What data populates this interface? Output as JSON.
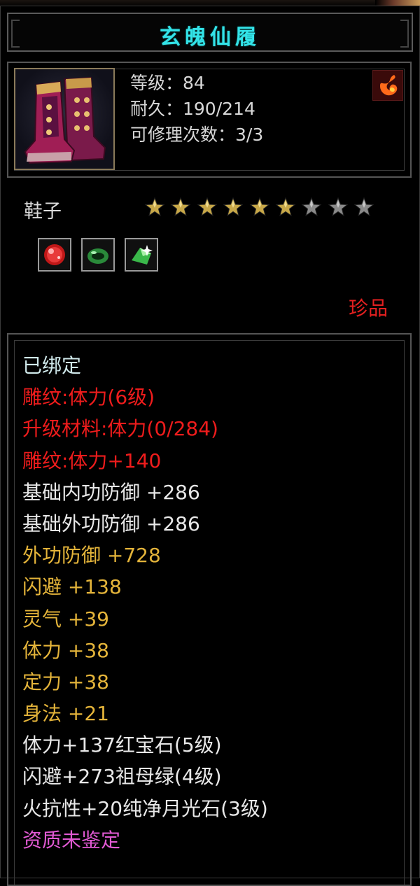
{
  "title": "玄魄仙履",
  "item": {
    "icon": "red-boots-icon",
    "stats": [
      "等级：84",
      "耐久：190/214",
      "可修理次数：3/3"
    ],
    "element_icon": "fire-icon",
    "category": "鞋子",
    "stars_filled": 6,
    "stars_total": 9,
    "gems": [
      "ruby-gem-icon",
      "jade-ring-gem-icon",
      "green-crystal-gem-icon"
    ],
    "rarity": "珍品"
  },
  "properties": [
    {
      "text": "已绑定",
      "color": "#cfe8ea"
    },
    {
      "text": "雕纹:体力(6级)",
      "color": "#ee1c1c"
    },
    {
      "text": "升级材料:体力(0/284)",
      "color": "#ee1c1c"
    },
    {
      "text": "雕纹:体力+140",
      "color": "#ee1c1c"
    },
    {
      "text": "基础内功防御 +286",
      "color": "#e8e8e8"
    },
    {
      "text": "基础外功防御 +286",
      "color": "#e8e8e8"
    },
    {
      "text": "外功防御 +728",
      "color": "#e4b43a"
    },
    {
      "text": "闪避 +138",
      "color": "#e4b43a"
    },
    {
      "text": "灵气 +39",
      "color": "#e4b43a"
    },
    {
      "text": "体力 +38",
      "color": "#e4b43a"
    },
    {
      "text": "定力 +38",
      "color": "#e4b43a"
    },
    {
      "text": "身法 +21",
      "color": "#e4b43a"
    },
    {
      "text": "体力+137红宝石(5级)",
      "color": "#e8e8e8"
    },
    {
      "text": "闪避+273祖母绿(4级)",
      "color": "#e8e8e8"
    },
    {
      "text": "火抗性+20纯净月光石(3级)",
      "color": "#e8e8e8"
    },
    {
      "text": "资质未鉴定",
      "color": "#e25ad4"
    }
  ]
}
